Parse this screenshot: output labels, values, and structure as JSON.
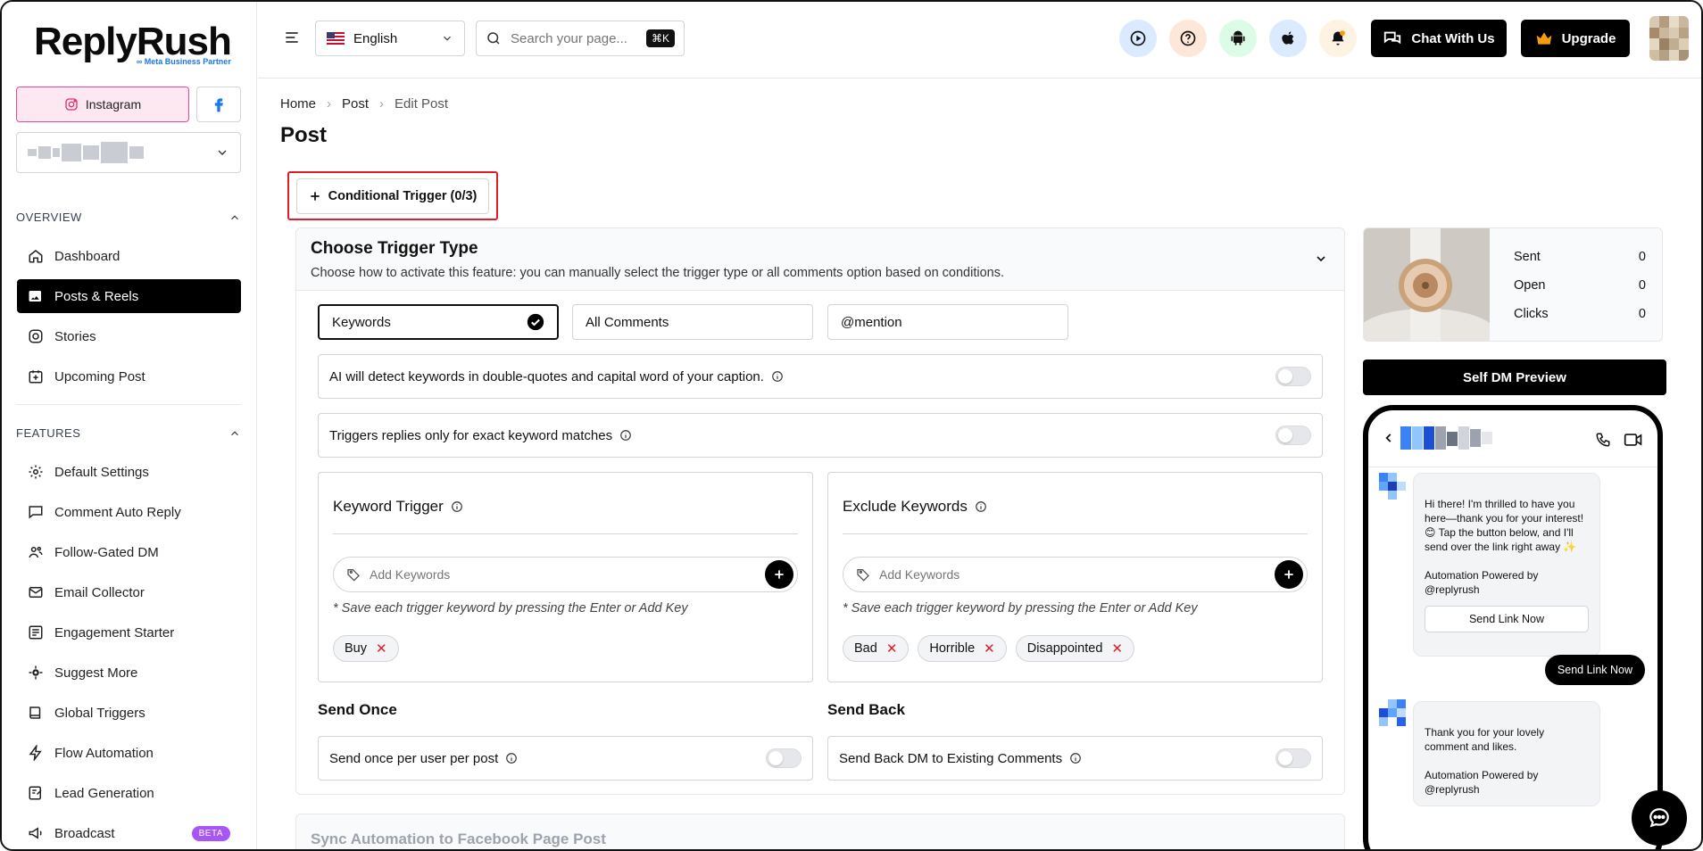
{
  "brand": {
    "name": "ReplyRush",
    "tagline": "Meta Business Partner"
  },
  "sidebar": {
    "platforms": {
      "instagram": "Instagram"
    },
    "overview_label": "OVERVIEW",
    "features_label": "FEATURES",
    "overview_items": [
      {
        "label": "Dashboard",
        "icon": "home-icon",
        "active": false
      },
      {
        "label": "Posts & Reels",
        "icon": "image-icon",
        "active": true
      },
      {
        "label": "Stories",
        "icon": "instagram-icon",
        "active": false
      },
      {
        "label": "Upcoming Post",
        "icon": "calendar-plus-icon",
        "active": false
      }
    ],
    "feature_items": [
      {
        "label": "Default Settings",
        "icon": "gear-icon"
      },
      {
        "label": "Comment Auto Reply",
        "icon": "comment-icon"
      },
      {
        "label": "Follow-Gated DM",
        "icon": "users-icon"
      },
      {
        "label": "Email Collector",
        "icon": "mail-icon"
      },
      {
        "label": "Engagement Starter",
        "icon": "list-icon"
      },
      {
        "label": "Suggest More",
        "icon": "cog-sparkle-icon"
      },
      {
        "label": "Global Triggers",
        "icon": "book-icon"
      },
      {
        "label": "Flow Automation",
        "icon": "bolt-icon"
      },
      {
        "label": "Lead Generation",
        "icon": "edit-icon"
      },
      {
        "label": "Broadcast",
        "icon": "megaphone-icon",
        "badge": "BETA"
      }
    ]
  },
  "topbar": {
    "language": "English",
    "search_placeholder": "Search your page...",
    "search_shortcut": "⌘K",
    "chat_label": "Chat With Us",
    "upgrade_label": "Upgrade"
  },
  "breadcrumb": [
    "Home",
    "Post",
    "Edit Post"
  ],
  "page_title": "Post",
  "conditional_trigger": "Conditional Trigger (0/3)",
  "trigger_card": {
    "title": "Choose Trigger Type",
    "description": "Choose how to activate this feature: you can manually select the trigger type or all comments option based on conditions.",
    "types": [
      "Keywords",
      "All Comments",
      "@mention"
    ],
    "selected_type": "Keywords",
    "options": [
      "AI will detect keywords in double-quotes and capital word of your caption.",
      "Triggers replies only for exact keyword matches"
    ],
    "keyword_trigger": {
      "title": "Keyword Trigger",
      "placeholder": "Add Keywords",
      "hint": "* Save each trigger keyword by pressing the Enter or Add Key",
      "chips": [
        "Buy"
      ]
    },
    "exclude_keywords": {
      "title": "Exclude Keywords",
      "placeholder": "Add Keywords",
      "hint": "* Save each trigger keyword by pressing the Enter or Add Key",
      "chips": [
        "Bad",
        "Horrible",
        "Disappointed"
      ]
    },
    "send_once": {
      "title": "Send Once",
      "label": "Send once per user per post"
    },
    "send_back": {
      "title": "Send Back",
      "label": "Send Back DM to Existing Comments"
    }
  },
  "sync_card": {
    "title": "Sync Automation to Facebook Page Post"
  },
  "preview": {
    "stats": [
      {
        "label": "Sent",
        "value": "0"
      },
      {
        "label": "Open",
        "value": "0"
      },
      {
        "label": "Clicks",
        "value": "0"
      }
    ],
    "self_dm_label": "Self DM Preview",
    "message1": "Hi there! I'm thrilled to have you here—thank you for your interest! 😊 Tap the button below, and I'll send over the link right away ✨\n\nAutomation Powered by @replyrush",
    "message1_button": "Send Link Now",
    "outgoing": "Send Link Now",
    "message2": "Thank you for your lovely comment and likes.\n\nAutomation Powered by @replyrush"
  },
  "colors": {
    "accent": "#000000",
    "highlight": "#e11d2a",
    "instagram_bg": "#fde7f1",
    "beta": "#a855f7"
  }
}
